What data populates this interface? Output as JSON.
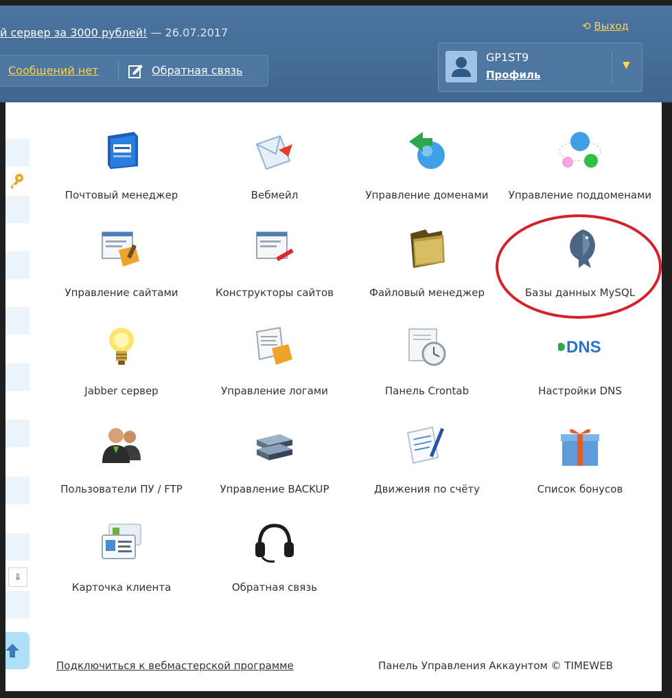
{
  "header": {
    "promo_link": "й сервер за 3000 рублей!",
    "promo_date": "— 26.07.2017",
    "messages_label": "Сообщений нет",
    "feedback_label": "Обратная связь",
    "exit_icon": "⟲",
    "exit_label": "Выход",
    "username": "GP1ST9",
    "profile_label": "Профиль",
    "dropdown_icon": "▼"
  },
  "tiles": [
    {
      "label": "Почтовый менеджер",
      "icon": "mailbox-icon"
    },
    {
      "label": "Вебмейл",
      "icon": "envelope-icon"
    },
    {
      "label": "Управление доменами",
      "icon": "domain-globe-icon"
    },
    {
      "label": "Управление поддоменами",
      "icon": "subdomain-spheres-icon"
    },
    {
      "label": "Управление сайтами",
      "icon": "site-window-icon"
    },
    {
      "label": "Конструкторы сайтов",
      "icon": "site-builder-icon"
    },
    {
      "label": "Файловый менеджер",
      "icon": "folder-icon"
    },
    {
      "label": "Базы данных MySQL",
      "icon": "mysql-dolphin-icon"
    },
    {
      "label": "Jabber сервер",
      "icon": "lightbulb-icon"
    },
    {
      "label": "Управление логами",
      "icon": "logs-icon"
    },
    {
      "label": "Панель Crontab",
      "icon": "crontab-clock-icon"
    },
    {
      "label": "Настройки DNS",
      "icon": "dns-icon",
      "icon_text": "DNS"
    },
    {
      "label": "Пользователи ПУ / FTP",
      "icon": "users-icon"
    },
    {
      "label": "Управление BACKUP",
      "icon": "server-backup-icon"
    },
    {
      "label": "Движения по счёту",
      "icon": "document-pen-icon"
    },
    {
      "label": "Список бонусов",
      "icon": "gift-icon"
    },
    {
      "label": "Карточка клиента",
      "icon": "client-card-icon"
    },
    {
      "label": "Обратная связь",
      "icon": "headset-icon"
    }
  ],
  "footer": {
    "webmaster_link": "Подключиться к вебмастерской программе",
    "copyright": "Панель Управления Аккаунтом © TIMEWEB"
  },
  "sidebar": {
    "select_icon": "⇩"
  },
  "colors": {
    "header_bg": "#466e96",
    "link_yellow": "#ffd34d",
    "highlight_red": "#d6202a"
  }
}
